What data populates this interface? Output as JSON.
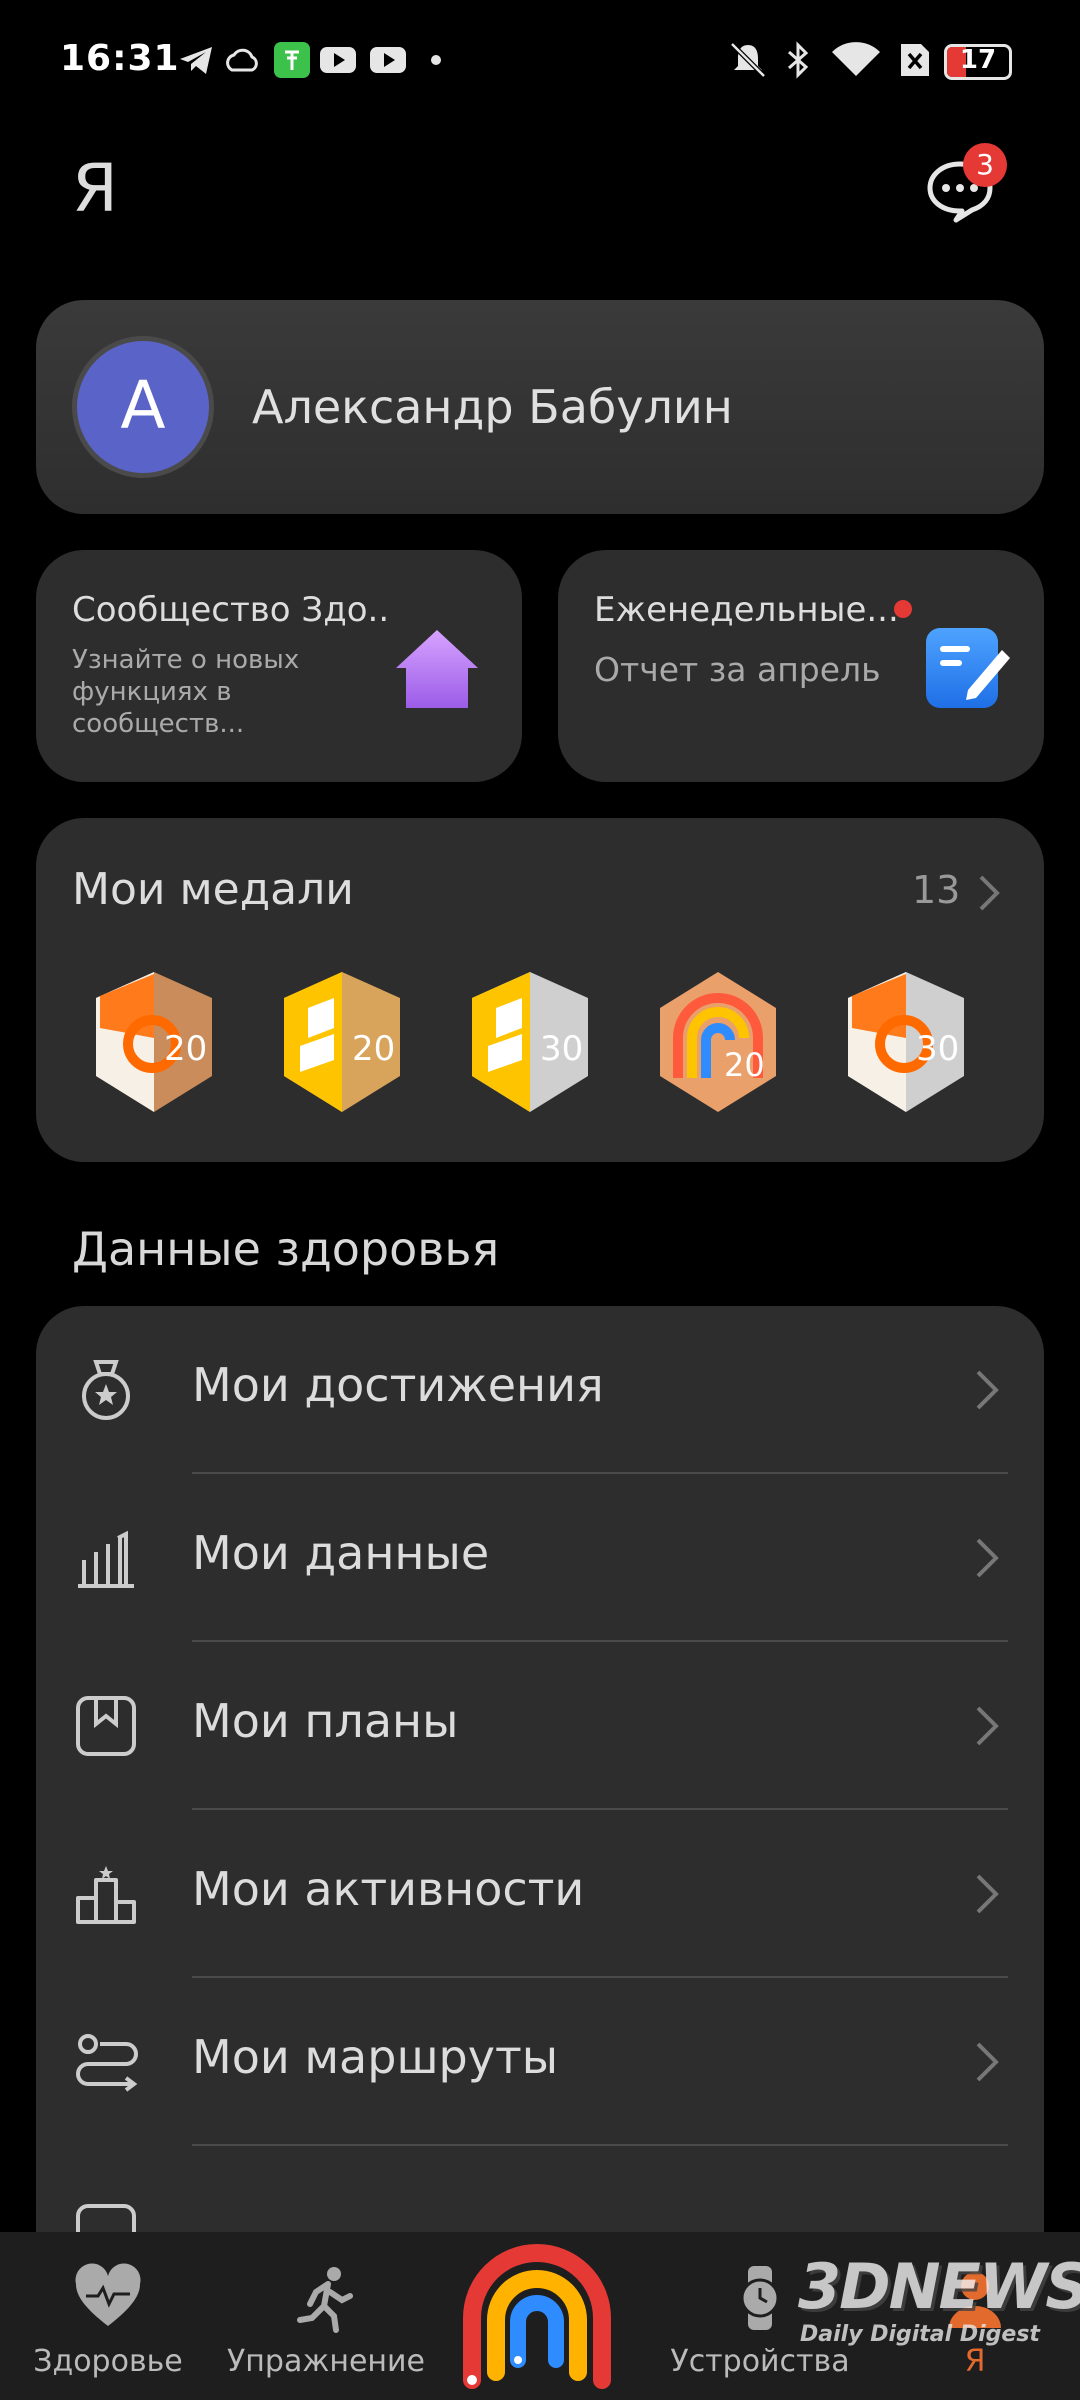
{
  "status_bar": {
    "time": "16:31",
    "battery": "17",
    "icons": [
      "telegram-icon",
      "cloud-icon",
      "app-icon",
      "youtube-icon",
      "youtube-icon",
      "dot-icon",
      "mute-icon",
      "bluetooth-icon",
      "wifi-icon",
      "sim-off-icon",
      "battery-icon"
    ]
  },
  "header": {
    "title": "Я",
    "messages_badge": "3"
  },
  "profile": {
    "avatar_letter": "А",
    "name": "Александр Бабулин"
  },
  "community": {
    "title": "Сообщество Здо...",
    "subtitle": "Узнайте о новых функциях в сообществ..."
  },
  "weekly": {
    "title": "Еженедельные...",
    "subtitle": "Отчет за апрель"
  },
  "medals": {
    "title": "Мои медали",
    "count": "13",
    "items": [
      "medal-20-orange",
      "medal-20-yellow",
      "medal-30-yellow",
      "medal-20-rainbow",
      "medal-30-orange"
    ]
  },
  "health": {
    "title": "Данные здоровья",
    "items": [
      {
        "label": "Мои достижения",
        "icon": "medal-icon"
      },
      {
        "label": "Мои данные",
        "icon": "bar-chart-icon"
      },
      {
        "label": "Мои планы",
        "icon": "bookmark-icon"
      },
      {
        "label": "Мои активности",
        "icon": "podium-icon"
      },
      {
        "label": "Мои маршруты",
        "icon": "route-icon"
      }
    ]
  },
  "nav": {
    "health": "Здоровье",
    "exercise": "Упражнение",
    "devices": "Устройства",
    "me": "Я"
  },
  "watermark": {
    "brand": "3DNEWS",
    "tagline": "Daily Digital Digest"
  },
  "colors": {
    "accent": "#e53935",
    "avatar": "#5a63c7",
    "card": "#2d2d2d"
  }
}
